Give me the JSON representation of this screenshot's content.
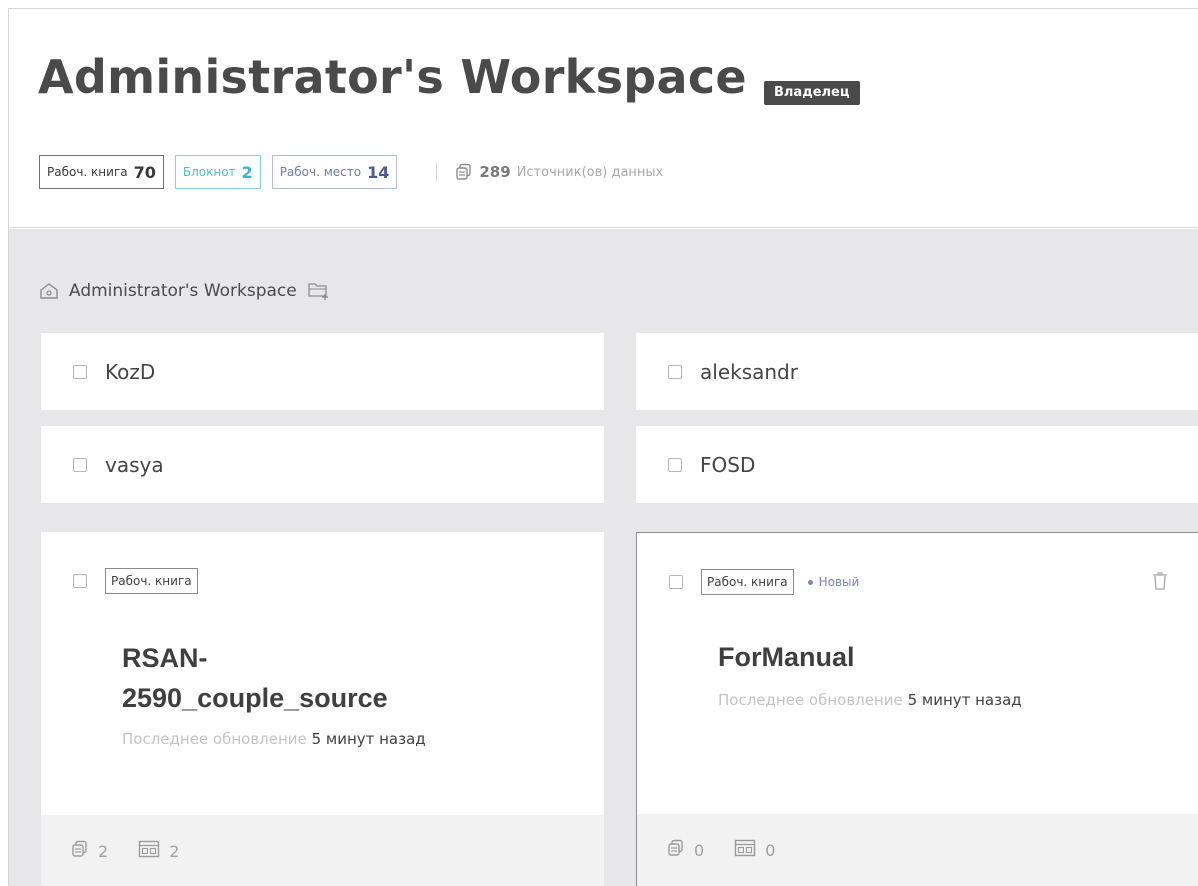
{
  "header": {
    "title": "Administrator's Workspace",
    "owner_badge": "Владелец",
    "counters": [
      {
        "label": "Рабоч. книга",
        "value": "70"
      },
      {
        "label": "Блокнот",
        "value": "2"
      },
      {
        "label": "Рабоч. место",
        "value": "14"
      }
    ],
    "sources": {
      "value": "289",
      "label": "Источник(ов) данных"
    }
  },
  "breadcrumb": {
    "label": "Administrator's Workspace"
  },
  "folders": [
    {
      "name": "KozD"
    },
    {
      "name": "aleksandr"
    },
    {
      "name": "vasya"
    },
    {
      "name": "FOSD"
    }
  ],
  "workbooks": [
    {
      "tag": "Рабоч. книга",
      "name_line1": "RSAN-",
      "name_line2": "2590_couple_source",
      "updated_label": "Последнее обновление",
      "updated_value": "5 минут назад",
      "sources_count": "2",
      "sheets_count": "2"
    },
    {
      "tag": "Рабоч. книга",
      "new_label": "Новый",
      "name_line1": "ForManual",
      "updated_label": "Последнее обновление",
      "updated_value": "5 минут назад",
      "sources_count": "0",
      "sheets_count": "0"
    }
  ],
  "colors": {
    "content_bg": "#e7e7ea",
    "notebook_accent": "#35b6cc",
    "workspace_accent": "#4c5a91",
    "new_badge": "#7a84bd"
  }
}
